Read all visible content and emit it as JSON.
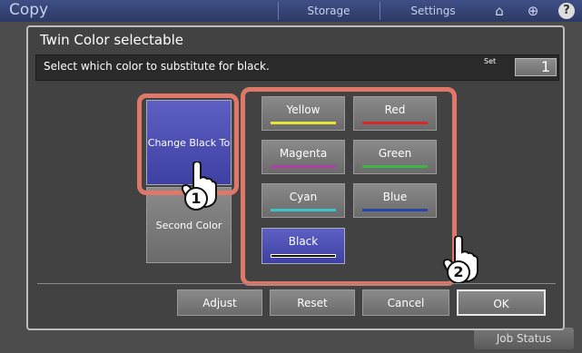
{
  "app": {
    "title": "Copy",
    "tabs": [
      "Storage",
      "Settings"
    ],
    "job_status_label": "Job Status"
  },
  "dialog": {
    "title": "Twin Color selectable",
    "instruction": "Select which color to substitute for black.",
    "set_label": "Set",
    "set_value": "1",
    "change_black_label": "Change Black To",
    "second_color_label": "Second Color",
    "colors": [
      {
        "label": "Yellow",
        "color": "#e8e23a"
      },
      {
        "label": "Red",
        "color": "#d9262b"
      },
      {
        "label": "Magenta",
        "color": "#b23fa4"
      },
      {
        "label": "Green",
        "color": "#3db44a"
      },
      {
        "label": "Cyan",
        "color": "#3cc3c9"
      },
      {
        "label": "Blue",
        "color": "#2745a9"
      },
      {
        "label": "Black",
        "color": "#111111"
      }
    ],
    "buttons": {
      "adjust": "Adjust",
      "reset": "Reset",
      "cancel": "Cancel",
      "ok": "OK"
    },
    "steps": [
      "1",
      "2"
    ]
  }
}
